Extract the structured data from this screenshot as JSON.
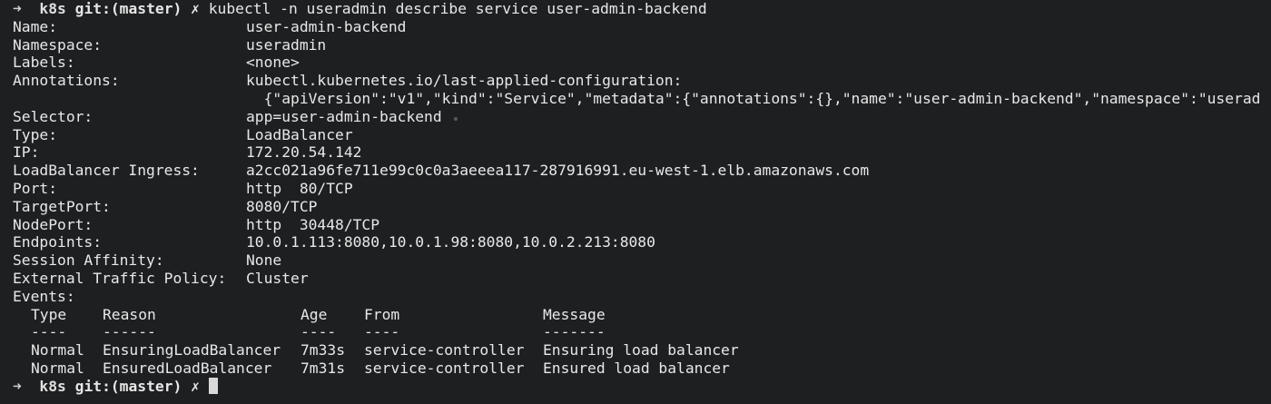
{
  "prompt": {
    "arrow": "➜",
    "dir": "k8s",
    "git_label": "git:",
    "branch": "(master)",
    "dirty_mark": "✗"
  },
  "command": "kubectl -n useradmin describe service user-admin-backend",
  "fields": [
    {
      "key": "Name:",
      "value": "user-admin-backend"
    },
    {
      "key": "Namespace:",
      "value": "useradmin"
    },
    {
      "key": "Labels:",
      "value": "<none>"
    },
    {
      "key": "Annotations:",
      "value": "kubectl.kubernetes.io/last-applied-configuration:"
    },
    {
      "key": "",
      "value": "  {\"apiVersion\":\"v1\",\"kind\":\"Service\",\"metadata\":{\"annotations\":{},\"name\":\"user-admin-backend\",\"namespace\":\"userad"
    },
    {
      "key": "Selector:",
      "value": "app=user-admin-backend"
    },
    {
      "key": "Type:",
      "value": "LoadBalancer"
    },
    {
      "key": "IP:",
      "value": "172.20.54.142"
    },
    {
      "key": "LoadBalancer Ingress:",
      "value": "a2cc021a96fe711e99c0c0a3aeeea117-287916991.eu-west-1.elb.amazonaws.com"
    },
    {
      "key": "Port:",
      "value": "http  80/TCP"
    },
    {
      "key": "TargetPort:",
      "value": "8080/TCP"
    },
    {
      "key": "NodePort:",
      "value": "http  30448/TCP"
    },
    {
      "key": "Endpoints:",
      "value": "10.0.1.113:8080,10.0.1.98:8080,10.0.2.213:8080"
    },
    {
      "key": "Session Affinity:",
      "value": "None"
    },
    {
      "key": "External Traffic Policy:",
      "value": "Cluster"
    },
    {
      "key": "Events:",
      "value": ""
    }
  ],
  "events": {
    "headers": [
      "Type",
      "Reason",
      "Age",
      "From",
      "Message"
    ],
    "underlines": [
      "----",
      "------",
      "----",
      "----",
      "-------"
    ],
    "rows": [
      [
        "Normal",
        "EnsuringLoadBalancer",
        "7m33s",
        "service-controller",
        "Ensuring load balancer"
      ],
      [
        "Normal",
        "EnsuredLoadBalancer",
        "7m31s",
        "service-controller",
        "Ensured load balancer"
      ]
    ]
  }
}
